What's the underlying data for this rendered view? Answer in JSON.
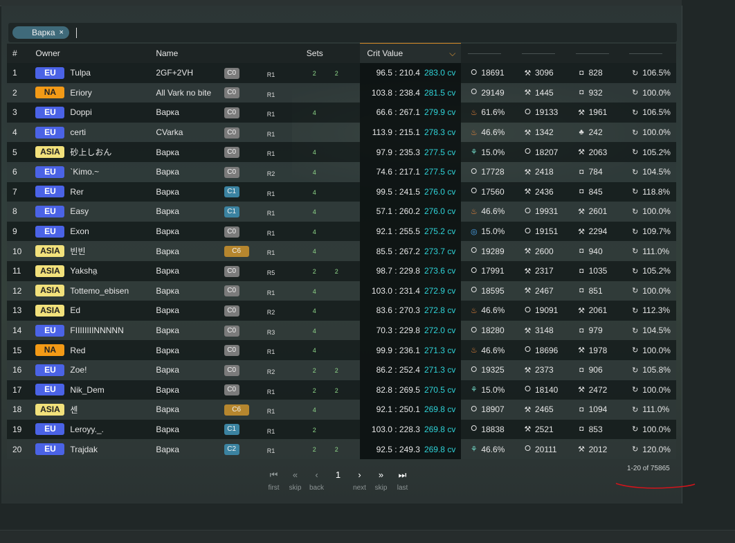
{
  "filter": {
    "chip_label": "Варка",
    "chip_close": "×"
  },
  "headers": {
    "num": "#",
    "owner": "Owner",
    "name": "Name",
    "sets": "Sets",
    "crit": "Crit Value"
  },
  "rows": [
    {
      "num": "1",
      "region": "EU",
      "owner": "Tulpa",
      "name": "2GF+2VH",
      "const": "C0",
      "refine": "R1",
      "set1": "2",
      "set2": "2",
      "ratio": "96.5 : 210.4",
      "cv": "283.0 cv",
      "stats": [
        {
          "icon": "hp-icon",
          "val": "18691"
        },
        {
          "icon": "atk-icon",
          "val": "3096"
        },
        {
          "icon": "def-icon",
          "val": "828"
        },
        {
          "icon": "er-icon",
          "val": "106.5%"
        }
      ]
    },
    {
      "num": "2",
      "region": "NA",
      "owner": "Eriory",
      "name": "All Vark no bite",
      "const": "C0",
      "refine": "R1",
      "set1": "",
      "set2": "",
      "ratio": "103.8 : 238.4",
      "cv": "281.5 cv",
      "stats": [
        {
          "icon": "hp-icon",
          "val": "29149"
        },
        {
          "icon": "atk-icon",
          "val": "1445"
        },
        {
          "icon": "def-icon",
          "val": "932"
        },
        {
          "icon": "er-icon",
          "val": "100.0%"
        }
      ]
    },
    {
      "num": "3",
      "region": "EU",
      "owner": "Doppi",
      "name": "Варка",
      "const": "C0",
      "refine": "R1",
      "set1": "4",
      "set2": "",
      "ratio": "66.6 : 267.1",
      "cv": "279.9 cv",
      "stats": [
        {
          "icon": "pyro-icon",
          "val": "61.6%"
        },
        {
          "icon": "hp-icon",
          "val": "19133"
        },
        {
          "icon": "atk-icon",
          "val": "1961"
        },
        {
          "icon": "er-icon",
          "val": "106.5%"
        }
      ]
    },
    {
      "num": "4",
      "region": "EU",
      "owner": "certi",
      "name": "CVarka",
      "const": "C0",
      "refine": "R1",
      "set1": "",
      "set2": "",
      "ratio": "113.9 : 215.1",
      "cv": "278.3 cv",
      "stats": [
        {
          "icon": "pyro-icon",
          "val": "46.6%"
        },
        {
          "icon": "atk-icon",
          "val": "1342"
        },
        {
          "icon": "em-icon",
          "val": "242"
        },
        {
          "icon": "er-icon",
          "val": "100.0%"
        }
      ]
    },
    {
      "num": "5",
      "region": "ASIA",
      "owner": "砂上しおん",
      "name": "Варка",
      "const": "C0",
      "refine": "R1",
      "set1": "4",
      "set2": "",
      "ratio": "97.9 : 235.3",
      "cv": "277.5 cv",
      "stats": [
        {
          "icon": "anemo-icon",
          "val": "15.0%"
        },
        {
          "icon": "hp-icon",
          "val": "18207"
        },
        {
          "icon": "atk-icon",
          "val": "2063"
        },
        {
          "icon": "er-icon",
          "val": "105.2%"
        }
      ]
    },
    {
      "num": "6",
      "region": "EU",
      "owner": "`Kimo.~",
      "name": "Варка",
      "const": "C0",
      "refine": "R2",
      "set1": "4",
      "set2": "",
      "ratio": "74.6 : 217.1",
      "cv": "277.5 cv",
      "stats": [
        {
          "icon": "hp-icon",
          "val": "17728"
        },
        {
          "icon": "atk-icon",
          "val": "2418"
        },
        {
          "icon": "def-icon",
          "val": "784"
        },
        {
          "icon": "er-icon",
          "val": "104.5%"
        }
      ]
    },
    {
      "num": "7",
      "region": "EU",
      "owner": "Rer",
      "name": "Варка",
      "const": "C1",
      "refine": "R1",
      "set1": "4",
      "set2": "",
      "ratio": "99.5 : 241.5",
      "cv": "276.0 cv",
      "stats": [
        {
          "icon": "hp-icon",
          "val": "17560"
        },
        {
          "icon": "atk-icon",
          "val": "2436"
        },
        {
          "icon": "def-icon",
          "val": "845"
        },
        {
          "icon": "er-icon",
          "val": "118.8%"
        }
      ]
    },
    {
      "num": "8",
      "region": "EU",
      "owner": "Easy",
      "name": "Варка",
      "const": "C1",
      "refine": "R1",
      "set1": "4",
      "set2": "",
      "ratio": "57.1 : 260.2",
      "cv": "276.0 cv",
      "stats": [
        {
          "icon": "pyro-icon",
          "val": "46.6%"
        },
        {
          "icon": "hp-icon",
          "val": "19931"
        },
        {
          "icon": "atk-icon",
          "val": "2601"
        },
        {
          "icon": "er-icon",
          "val": "100.0%"
        }
      ]
    },
    {
      "num": "9",
      "region": "EU",
      "owner": "Exon",
      "name": "Варка",
      "const": "C0",
      "refine": "R1",
      "set1": "4",
      "set2": "",
      "ratio": "92.1 : 255.5",
      "cv": "275.2 cv",
      "stats": [
        {
          "icon": "hydro-icon",
          "val": "15.0%"
        },
        {
          "icon": "hp-icon",
          "val": "19151"
        },
        {
          "icon": "atk-icon",
          "val": "2294"
        },
        {
          "icon": "er-icon",
          "val": "109.7%"
        }
      ]
    },
    {
      "num": "10",
      "region": "ASIA",
      "owner": "빈빈",
      "name": "Варка",
      "const": "C6",
      "refine": "R1",
      "set1": "4",
      "set2": "",
      "ratio": "85.5 : 267.2",
      "cv": "273.7 cv",
      "stats": [
        {
          "icon": "hp-icon",
          "val": "19289"
        },
        {
          "icon": "atk-icon",
          "val": "2600"
        },
        {
          "icon": "def-icon",
          "val": "940"
        },
        {
          "icon": "er-icon",
          "val": "111.0%"
        }
      ]
    },
    {
      "num": "11",
      "region": "ASIA",
      "owner": "Yaksha̤",
      "name": "Варка",
      "const": "C0",
      "refine": "R5",
      "set1": "2",
      "set2": "2",
      "ratio": "98.7 : 229.8",
      "cv": "273.6 cv",
      "stats": [
        {
          "icon": "hp-icon",
          "val": "17991"
        },
        {
          "icon": "atk-icon",
          "val": "2317"
        },
        {
          "icon": "def-icon",
          "val": "1035"
        },
        {
          "icon": "er-icon",
          "val": "105.2%"
        }
      ]
    },
    {
      "num": "12",
      "region": "ASIA",
      "owner": "Tottemo_ebisen",
      "name": "Варка",
      "const": "C0",
      "refine": "R1",
      "set1": "4",
      "set2": "",
      "ratio": "103.0 : 231.4",
      "cv": "272.9 cv",
      "stats": [
        {
          "icon": "hp-icon",
          "val": "18595"
        },
        {
          "icon": "atk-icon",
          "val": "2467"
        },
        {
          "icon": "def-icon",
          "val": "851"
        },
        {
          "icon": "er-icon",
          "val": "100.0%"
        }
      ]
    },
    {
      "num": "13",
      "region": "ASIA",
      "owner": "Ed",
      "name": "Варка",
      "const": "C0",
      "refine": "R2",
      "set1": "4",
      "set2": "",
      "ratio": "83.6 : 270.3",
      "cv": "272.8 cv",
      "stats": [
        {
          "icon": "pyro-icon",
          "val": "46.6%"
        },
        {
          "icon": "hp-icon",
          "val": "19091"
        },
        {
          "icon": "atk-icon",
          "val": "2061"
        },
        {
          "icon": "er-icon",
          "val": "112.3%"
        }
      ]
    },
    {
      "num": "14",
      "region": "EU",
      "owner": "FIIIIIIIINNNNN",
      "name": "Варка",
      "const": "C0",
      "refine": "R3",
      "set1": "4",
      "set2": "",
      "ratio": "70.3 : 229.8",
      "cv": "272.0 cv",
      "stats": [
        {
          "icon": "hp-icon",
          "val": "18280"
        },
        {
          "icon": "atk-icon",
          "val": "3148"
        },
        {
          "icon": "def-icon",
          "val": "979"
        },
        {
          "icon": "er-icon",
          "val": "104.5%"
        }
      ]
    },
    {
      "num": "15",
      "region": "NA",
      "owner": "Red",
      "name": "Варка",
      "const": "C0",
      "refine": "R1",
      "set1": "4",
      "set2": "",
      "ratio": "99.9 : 236.1",
      "cv": "271.3 cv",
      "stats": [
        {
          "icon": "pyro-icon",
          "val": "46.6%"
        },
        {
          "icon": "hp-icon",
          "val": "18696"
        },
        {
          "icon": "atk-icon",
          "val": "1978"
        },
        {
          "icon": "er-icon",
          "val": "100.0%"
        }
      ]
    },
    {
      "num": "16",
      "region": "EU",
      "owner": "Zoe!",
      "name": "Варка",
      "const": "C0",
      "refine": "R2",
      "set1": "2",
      "set2": "2",
      "ratio": "86.2 : 252.4",
      "cv": "271.3 cv",
      "stats": [
        {
          "icon": "hp-icon",
          "val": "19325"
        },
        {
          "icon": "atk-icon",
          "val": "2373"
        },
        {
          "icon": "def-icon",
          "val": "906"
        },
        {
          "icon": "er-icon",
          "val": "105.8%"
        }
      ]
    },
    {
      "num": "17",
      "region": "EU",
      "owner": "Nik_Dem",
      "name": "Варка",
      "const": "C0",
      "refine": "R1",
      "set1": "2",
      "set2": "2",
      "ratio": "82.8 : 269.5",
      "cv": "270.5 cv",
      "stats": [
        {
          "icon": "anemo-icon",
          "val": "15.0%"
        },
        {
          "icon": "hp-icon",
          "val": "18140"
        },
        {
          "icon": "atk-icon",
          "val": "2472"
        },
        {
          "icon": "er-icon",
          "val": "100.0%"
        }
      ]
    },
    {
      "num": "18",
      "region": "ASIA",
      "owner": "센",
      "name": "Варка",
      "const": "C6",
      "refine": "R1",
      "set1": "4",
      "set2": "",
      "ratio": "92.1 : 250.1",
      "cv": "269.8 cv",
      "stats": [
        {
          "icon": "hp-icon",
          "val": "18907"
        },
        {
          "icon": "atk-icon",
          "val": "2465"
        },
        {
          "icon": "def-icon",
          "val": "1094"
        },
        {
          "icon": "er-icon",
          "val": "111.0%"
        }
      ]
    },
    {
      "num": "19",
      "region": "EU",
      "owner": "Leroyy._.",
      "name": "Варка",
      "const": "C1",
      "refine": "R1",
      "set1": "2",
      "set2": "",
      "ratio": "103.0 : 228.3",
      "cv": "269.8 cv",
      "stats": [
        {
          "icon": "hp-icon",
          "val": "18838"
        },
        {
          "icon": "atk-icon",
          "val": "2521"
        },
        {
          "icon": "def-icon",
          "val": "853"
        },
        {
          "icon": "er-icon",
          "val": "100.0%"
        }
      ]
    },
    {
      "num": "20",
      "region": "EU",
      "owner": "Trajdak",
      "name": "Варка",
      "const": "C2",
      "refine": "R1",
      "set1": "2",
      "set2": "2",
      "ratio": "92.5 : 249.3",
      "cv": "269.8 cv",
      "stats": [
        {
          "icon": "anemo-icon",
          "val": "46.6%"
        },
        {
          "icon": "hp-icon",
          "val": "20111"
        },
        {
          "icon": "atk-icon",
          "val": "2012"
        },
        {
          "icon": "er-icon",
          "val": "120.0%"
        }
      ]
    }
  ],
  "pager": {
    "first": "first",
    "skip_back": "skip",
    "back": "back",
    "current": "1",
    "next": "next",
    "skip_next": "skip",
    "last": "last"
  },
  "range": "1-20 of 75865",
  "colors": {
    "accent_sort": "#e39a36",
    "cv": "#2fd3d8",
    "eu": "#4b63e6",
    "na": "#f39a16",
    "asia": "#f2e17b",
    "annotation": "#d4141b"
  }
}
